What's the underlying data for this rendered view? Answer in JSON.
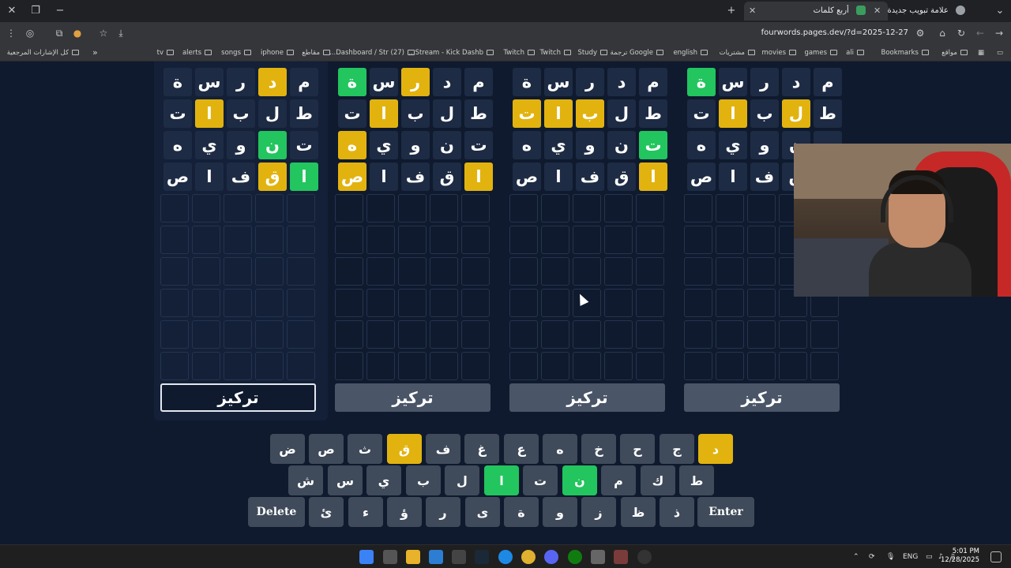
{
  "browser": {
    "tabs": [
      {
        "title": "أربع كلمات",
        "active": true
      },
      {
        "title": "علامة تبويب جديدة",
        "active": false
      }
    ],
    "url": "fourwords.pages.dev/?d=2025-12-27",
    "bookmarks_overflow": "»",
    "bookmarks": [
      "كل الإشارات المرجعية",
      "tv",
      "alerts",
      "songs",
      "iphone",
      "مقاطع",
      "(27) Dashboard / Str...",
      "Stream - Kick Dashb...",
      "Twitch",
      "Twitch",
      "Study",
      "Google ترجمة",
      "english",
      "مشتريات",
      "movies",
      "games",
      "ali",
      "Bookmarks",
      "مواقع"
    ]
  },
  "game": {
    "focus_label": "تركيز",
    "boards": [
      {
        "rows": [
          [
            {
              "l": "م",
              "s": "gray"
            },
            {
              "l": "د",
              "s": "yellow"
            },
            {
              "l": "ر",
              "s": "gray"
            },
            {
              "l": "س",
              "s": "gray"
            },
            {
              "l": "ة",
              "s": "gray"
            }
          ],
          [
            {
              "l": "ط",
              "s": "gray"
            },
            {
              "l": "ل",
              "s": "gray"
            },
            {
              "l": "ب",
              "s": "gray"
            },
            {
              "l": "ا",
              "s": "yellow"
            },
            {
              "l": "ت",
              "s": "gray"
            }
          ],
          [
            {
              "l": "ت",
              "s": "gray"
            },
            {
              "l": "ن",
              "s": "green"
            },
            {
              "l": "و",
              "s": "gray"
            },
            {
              "l": "ي",
              "s": "gray"
            },
            {
              "l": "ه",
              "s": "gray"
            }
          ],
          [
            {
              "l": "ا",
              "s": "green"
            },
            {
              "l": "ق",
              "s": "yellow"
            },
            {
              "l": "ف",
              "s": "gray"
            },
            {
              "l": "ا",
              "s": "gray"
            },
            {
              "l": "ص",
              "s": "gray"
            }
          ]
        ],
        "focused": true
      },
      {
        "rows": [
          [
            {
              "l": "م",
              "s": "gray"
            },
            {
              "l": "د",
              "s": "gray"
            },
            {
              "l": "ر",
              "s": "yellow"
            },
            {
              "l": "س",
              "s": "gray"
            },
            {
              "l": "ة",
              "s": "green"
            }
          ],
          [
            {
              "l": "ط",
              "s": "gray"
            },
            {
              "l": "ل",
              "s": "gray"
            },
            {
              "l": "ب",
              "s": "gray"
            },
            {
              "l": "ا",
              "s": "yellow"
            },
            {
              "l": "ت",
              "s": "gray"
            }
          ],
          [
            {
              "l": "ت",
              "s": "gray"
            },
            {
              "l": "ن",
              "s": "gray"
            },
            {
              "l": "و",
              "s": "gray"
            },
            {
              "l": "ي",
              "s": "gray"
            },
            {
              "l": "ه",
              "s": "yellow"
            }
          ],
          [
            {
              "l": "ا",
              "s": "yellow"
            },
            {
              "l": "ق",
              "s": "gray"
            },
            {
              "l": "ف",
              "s": "gray"
            },
            {
              "l": "ا",
              "s": "gray"
            },
            {
              "l": "ص",
              "s": "yellow"
            }
          ]
        ],
        "focused": false
      },
      {
        "rows": [
          [
            {
              "l": "م",
              "s": "gray"
            },
            {
              "l": "د",
              "s": "gray"
            },
            {
              "l": "ر",
              "s": "gray"
            },
            {
              "l": "س",
              "s": "gray"
            },
            {
              "l": "ة",
              "s": "gray"
            }
          ],
          [
            {
              "l": "ط",
              "s": "gray"
            },
            {
              "l": "ل",
              "s": "gray"
            },
            {
              "l": "ب",
              "s": "yellow"
            },
            {
              "l": "ا",
              "s": "yellow"
            },
            {
              "l": "ت",
              "s": "yellow"
            }
          ],
          [
            {
              "l": "ت",
              "s": "green"
            },
            {
              "l": "ن",
              "s": "gray"
            },
            {
              "l": "و",
              "s": "gray"
            },
            {
              "l": "ي",
              "s": "gray"
            },
            {
              "l": "ه",
              "s": "gray"
            }
          ],
          [
            {
              "l": "ا",
              "s": "yellow"
            },
            {
              "l": "ق",
              "s": "gray"
            },
            {
              "l": "ف",
              "s": "gray"
            },
            {
              "l": "ا",
              "s": "gray"
            },
            {
              "l": "ص",
              "s": "gray"
            }
          ]
        ],
        "focused": false
      },
      {
        "rows": [
          [
            {
              "l": "م",
              "s": "gray"
            },
            {
              "l": "د",
              "s": "gray"
            },
            {
              "l": "ر",
              "s": "gray"
            },
            {
              "l": "س",
              "s": "gray"
            },
            {
              "l": "ة",
              "s": "green"
            }
          ],
          [
            {
              "l": "ط",
              "s": "gray"
            },
            {
              "l": "ل",
              "s": "yellow"
            },
            {
              "l": "ب",
              "s": "gray"
            },
            {
              "l": "ا",
              "s": "yellow"
            },
            {
              "l": "ت",
              "s": "gray"
            }
          ],
          [
            {
              "l": "ت",
              "s": "gray"
            },
            {
              "l": "ن",
              "s": "gray"
            },
            {
              "l": "و",
              "s": "gray"
            },
            {
              "l": "ي",
              "s": "gray"
            },
            {
              "l": "ه",
              "s": "gray"
            }
          ],
          [
            {
              "l": "ا",
              "s": "yellow"
            },
            {
              "l": "ق",
              "s": "gray"
            },
            {
              "l": "ف",
              "s": "gray"
            },
            {
              "l": "ا",
              "s": "gray"
            },
            {
              "l": "ص",
              "s": "gray"
            }
          ]
        ],
        "focused": false
      }
    ],
    "empty_rows": 6,
    "keyboard": [
      [
        {
          "k": "د",
          "s": "yellow"
        },
        {
          "k": "ج",
          "s": "gray"
        },
        {
          "k": "ح",
          "s": "gray"
        },
        {
          "k": "خ",
          "s": "gray"
        },
        {
          "k": "ه",
          "s": "gray"
        },
        {
          "k": "ع",
          "s": "gray"
        },
        {
          "k": "غ",
          "s": "gray"
        },
        {
          "k": "ف",
          "s": "gray"
        },
        {
          "k": "ق",
          "s": "yellow"
        },
        {
          "k": "ث",
          "s": "gray"
        },
        {
          "k": "ص",
          "s": "gray"
        },
        {
          "k": "ض",
          "s": "gray"
        }
      ],
      [
        {
          "k": "ط",
          "s": "gray"
        },
        {
          "k": "ك",
          "s": "gray"
        },
        {
          "k": "م",
          "s": "gray"
        },
        {
          "k": "ن",
          "s": "green"
        },
        {
          "k": "ت",
          "s": "gray"
        },
        {
          "k": "ا",
          "s": "green"
        },
        {
          "k": "ل",
          "s": "gray"
        },
        {
          "k": "ب",
          "s": "gray"
        },
        {
          "k": "ي",
          "s": "gray"
        },
        {
          "k": "س",
          "s": "gray"
        },
        {
          "k": "ش",
          "s": "gray"
        }
      ],
      [
        {
          "k": "Enter",
          "s": "wide"
        },
        {
          "k": "ذ",
          "s": "gray"
        },
        {
          "k": "ظ",
          "s": "gray"
        },
        {
          "k": "ز",
          "s": "gray"
        },
        {
          "k": "و",
          "s": "gray"
        },
        {
          "k": "ة",
          "s": "gray"
        },
        {
          "k": "ى",
          "s": "gray"
        },
        {
          "k": "ر",
          "s": "gray"
        },
        {
          "k": "ؤ",
          "s": "gray"
        },
        {
          "k": "ء",
          "s": "gray"
        },
        {
          "k": "ئ",
          "s": "gray"
        },
        {
          "k": "Delete",
          "s": "wide"
        }
      ]
    ]
  },
  "taskbar": {
    "lang": "ENG",
    "time": "5:01 PM",
    "date": "12/28/2025"
  },
  "colors": {
    "background": "#0f1a2e",
    "tile_gray": "#1d2b44",
    "tile_yellow": "#e2b30f",
    "tile_green": "#22c55e",
    "focus_button": "#4a5568"
  }
}
